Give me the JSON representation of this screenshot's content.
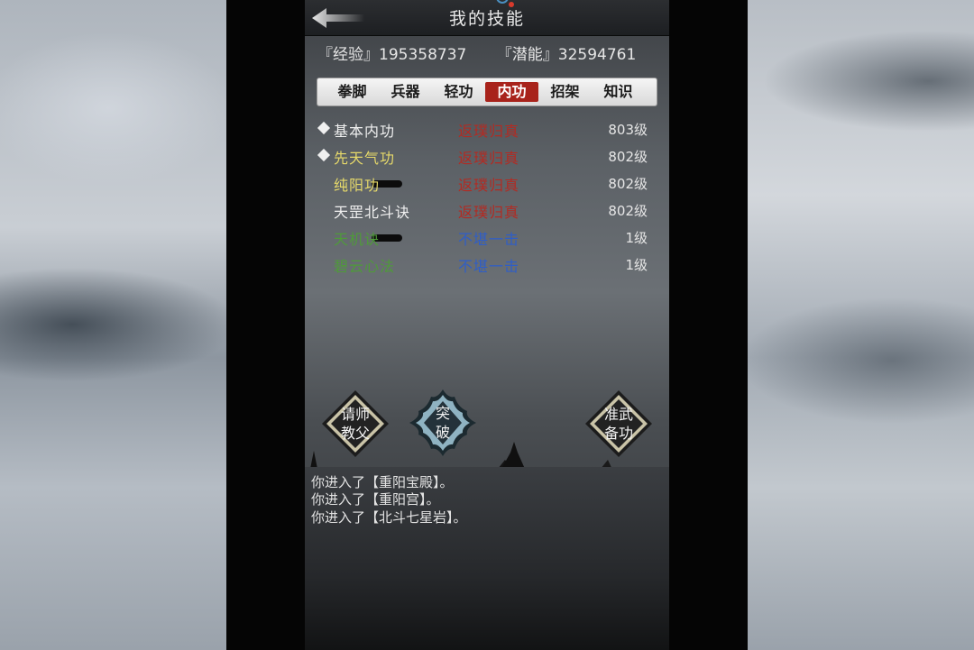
{
  "header": {
    "title": "我的技能"
  },
  "stats": {
    "experience": "『经验』195358737",
    "potential": "『潜能』32594761"
  },
  "tabs": [
    {
      "label": "拳脚"
    },
    {
      "label": "兵器"
    },
    {
      "label": "轻功"
    },
    {
      "label": "内功",
      "active": true
    },
    {
      "label": "招架"
    },
    {
      "label": "知识"
    }
  ],
  "skills": [
    {
      "name": "基本内功",
      "rank": "返璞归真",
      "level": "803级",
      "name_color": "#f0f0f0",
      "rank_color": "#b32a22",
      "marked": true
    },
    {
      "name": "先天气功",
      "rank": "返璞归真",
      "level": "802级",
      "name_color": "#e6d96a",
      "rank_color": "#b32a22",
      "marked": true
    },
    {
      "name": "纯阳功",
      "rank": "返璞归真",
      "level": "802级",
      "name_color": "#e6d96a",
      "rank_color": "#b32a22",
      "marked": false
    },
    {
      "name": "天罡北斗诀",
      "rank": "返璞归真",
      "level": "802级",
      "name_color": "#f0f0f0",
      "rank_color": "#b32a22",
      "marked": false
    },
    {
      "name": "天机诀",
      "rank": "不堪一击",
      "level": "1级",
      "name_color": "#4f9a3a",
      "rank_color": "#2f5ec7",
      "marked": false
    },
    {
      "name": "碧云心法",
      "rank": "不堪一击",
      "level": "1级",
      "name_color": "#4f9a3a",
      "rank_color": "#2f5ec7",
      "marked": false
    }
  ],
  "buttons": {
    "ask_master": {
      "line1": "请师",
      "line2": "教父"
    },
    "breakthrough": {
      "line1": "突",
      "line2": "破"
    },
    "prepare": {
      "line1": "准武",
      "line2": "备功"
    }
  },
  "log": [
    "你进入了【重阳宝殿】。",
    "你进入了【重阳宫】。",
    "你进入了【北斗七星岩】。"
  ],
  "colors": {
    "tab_active": "#a8231b",
    "rank_red": "#b32a22",
    "rank_blue": "#2f5ec7"
  }
}
